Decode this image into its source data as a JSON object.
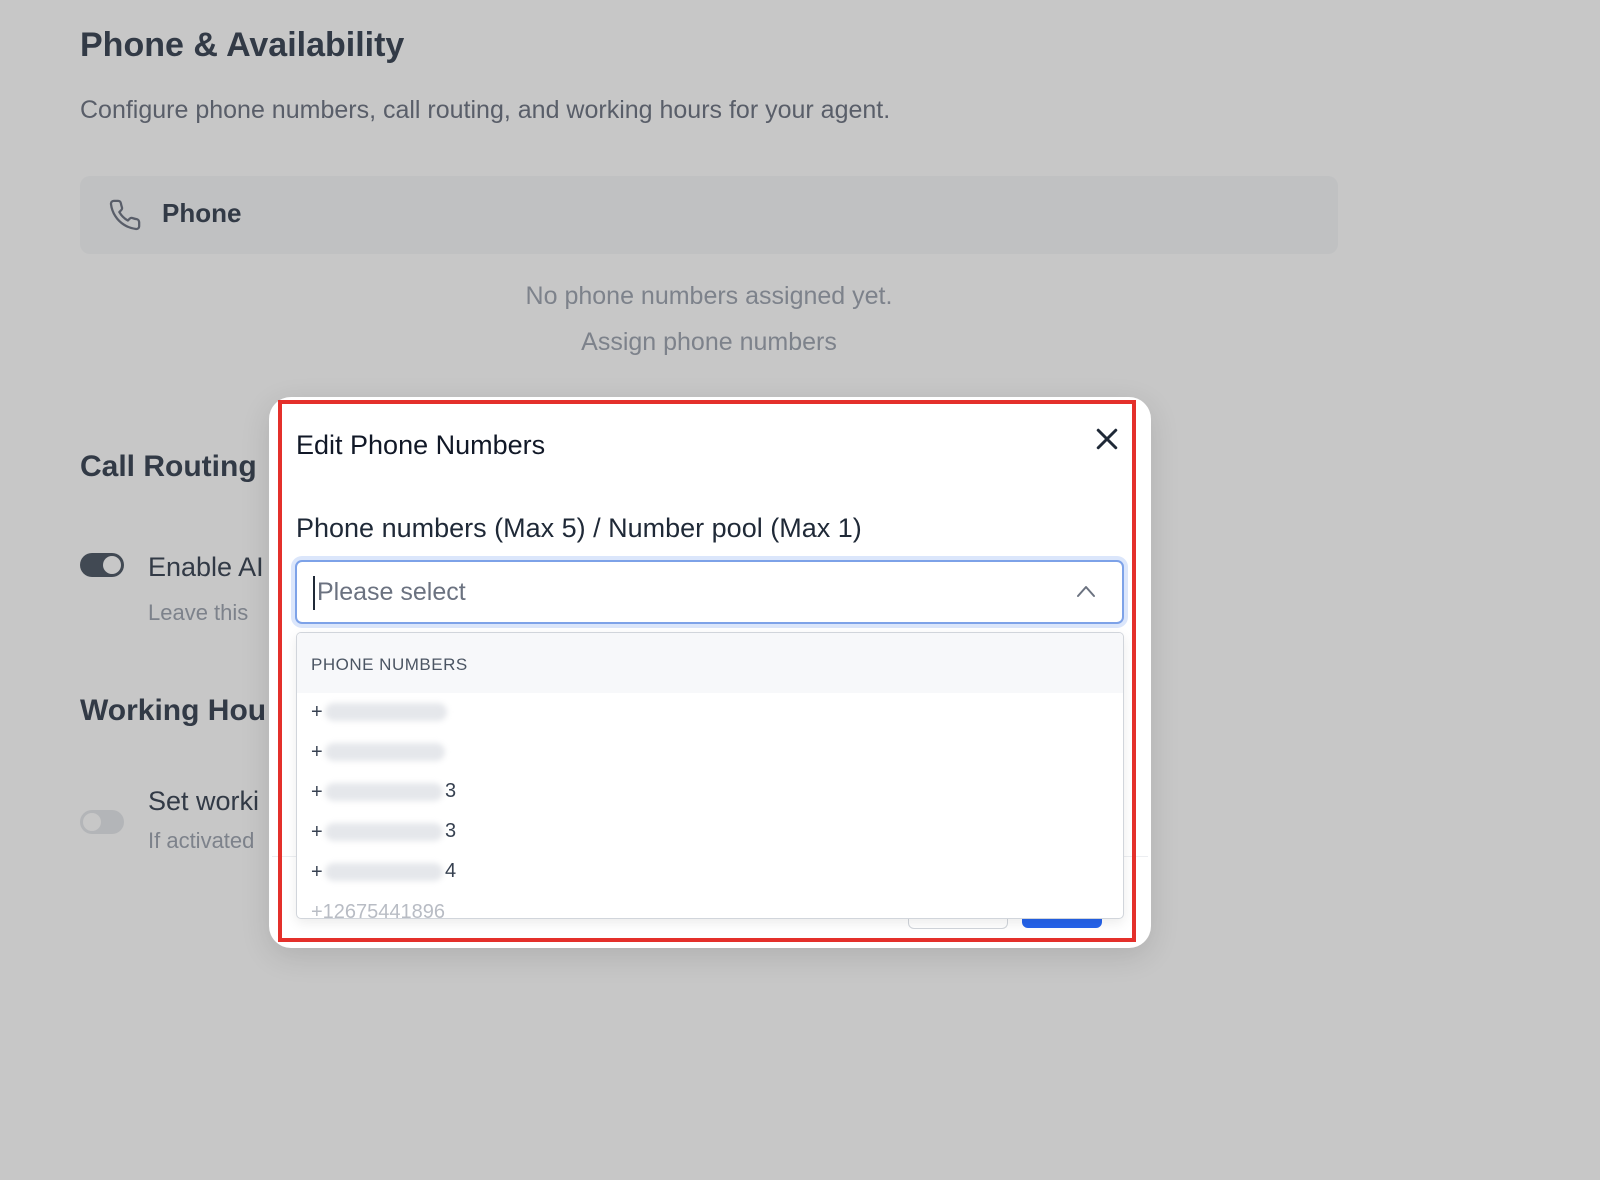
{
  "page": {
    "title": "Phone & Availability",
    "subtitle": "Configure phone numbers, call routing, and working hours for your agent.",
    "phone_section": {
      "label": "Phone",
      "empty_text": "No phone numbers assigned yet.",
      "assign_link": "Assign phone numbers"
    },
    "call_routing": {
      "title": "Call Routing",
      "enable_label": "Enable AI",
      "enable_help": "Leave this"
    },
    "working_hours": {
      "title": "Working Hou",
      "label": "Set worki",
      "help": "If activated"
    }
  },
  "modal": {
    "title": "Edit Phone Numbers",
    "field_label": "Phone numbers (Max 5) / Number pool (Max 1)",
    "placeholder": "Please select",
    "group_header": "PHONE NUMBERS",
    "options": [
      "+",
      "+",
      "+",
      "+",
      "+",
      "+12675441896"
    ],
    "option_tails": [
      "",
      "",
      "3",
      "3",
      "4",
      ""
    ]
  },
  "colors": {
    "highlight": "#e4302b",
    "primary": "#2563eb",
    "focus_border": "#7da2e8"
  }
}
